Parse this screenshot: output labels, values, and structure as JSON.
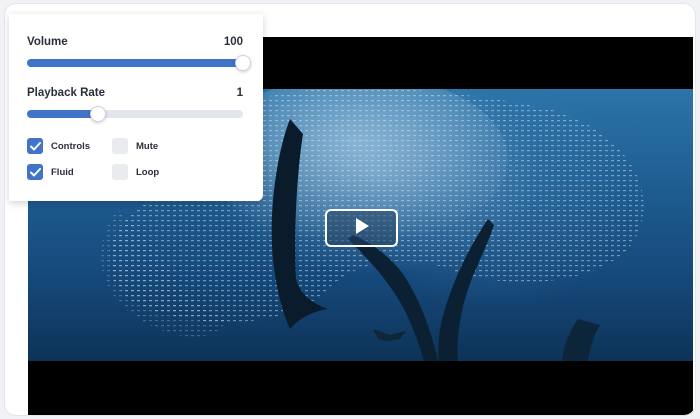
{
  "panel": {
    "volume": {
      "label": "Volume",
      "value": "100",
      "level": 1.0
    },
    "playback_rate": {
      "label": "Playback Rate",
      "value": "1",
      "level": 0.33
    },
    "options": [
      {
        "label": "Controls",
        "checked": true
      },
      {
        "label": "Mute",
        "checked": false
      },
      {
        "label": "Fluid",
        "checked": true
      },
      {
        "label": "Loop",
        "checked": false
      }
    ]
  },
  "player": {
    "big_play_icon": "play-icon"
  },
  "colors": {
    "accent": "#3f74c9",
    "track": "#e3e6ec",
    "unchecked": "#e9ebef",
    "letterbox": "#000000",
    "water": "#1f5e92"
  }
}
